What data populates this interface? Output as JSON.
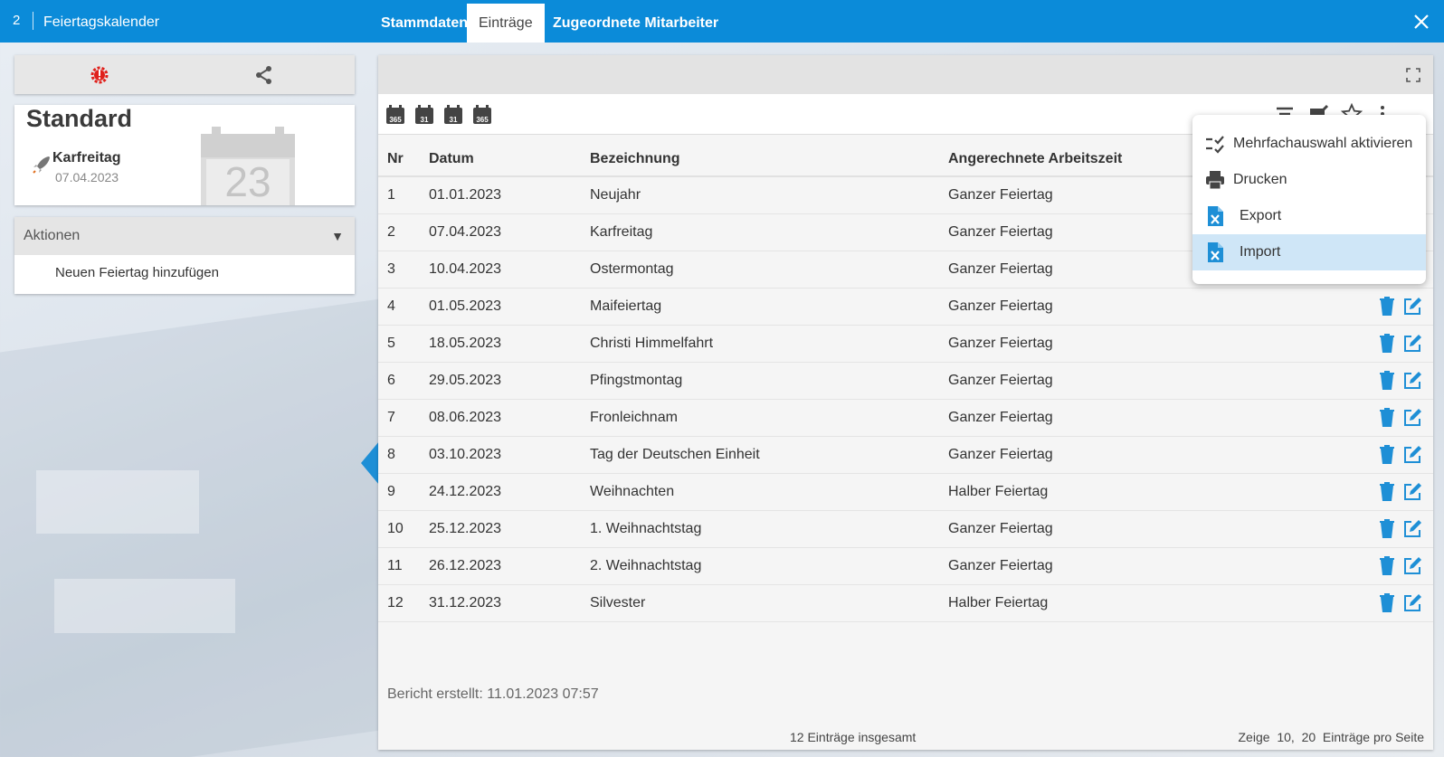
{
  "window": {
    "number": "2",
    "title": "Feiertagskalender",
    "tabs": [
      "Stammdaten",
      "Einträge",
      "Zugeordnete Mitarbeiter"
    ],
    "active_tab": "Einträge",
    "accent": "#0b8bd9"
  },
  "card": {
    "name": "Standard",
    "holiday_name": "Karfreitag",
    "holiday_date": "07.04.2023",
    "calendar_day": "23"
  },
  "actions": {
    "header": "Aktionen",
    "items": [
      "Neuen Feiertag hinzufügen"
    ]
  },
  "toolbar": {
    "calendar_buttons": [
      "365",
      "31",
      "31",
      "365"
    ]
  },
  "table": {
    "columns": [
      "Nr",
      "Datum",
      "Bezeichnung",
      "Angerechnete Arbeitszeit"
    ],
    "rows": [
      {
        "nr": "1",
        "datum": "01.01.2023",
        "bezeichnung": "Neujahr",
        "zeit": "Ganzer Feiertag"
      },
      {
        "nr": "2",
        "datum": "07.04.2023",
        "bezeichnung": "Karfreitag",
        "zeit": "Ganzer Feiertag"
      },
      {
        "nr": "3",
        "datum": "10.04.2023",
        "bezeichnung": "Ostermontag",
        "zeit": "Ganzer Feiertag"
      },
      {
        "nr": "4",
        "datum": "01.05.2023",
        "bezeichnung": "Maifeiertag",
        "zeit": "Ganzer Feiertag"
      },
      {
        "nr": "5",
        "datum": "18.05.2023",
        "bezeichnung": "Christi Himmelfahrt",
        "zeit": "Ganzer Feiertag"
      },
      {
        "nr": "6",
        "datum": "29.05.2023",
        "bezeichnung": "Pfingstmontag",
        "zeit": "Ganzer Feiertag"
      },
      {
        "nr": "7",
        "datum": "08.06.2023",
        "bezeichnung": "Fronleichnam",
        "zeit": "Ganzer Feiertag"
      },
      {
        "nr": "8",
        "datum": "03.10.2023",
        "bezeichnung": "Tag der Deutschen Einheit",
        "zeit": "Ganzer Feiertag"
      },
      {
        "nr": "9",
        "datum": "24.12.2023",
        "bezeichnung": "Weihnachten",
        "zeit": "Halber Feiertag"
      },
      {
        "nr": "10",
        "datum": "25.12.2023",
        "bezeichnung": "1. Weihnachtstag",
        "zeit": "Ganzer Feiertag"
      },
      {
        "nr": "11",
        "datum": "26.12.2023",
        "bezeichnung": "2. Weihnachtstag",
        "zeit": "Ganzer Feiertag"
      },
      {
        "nr": "12",
        "datum": "31.12.2023",
        "bezeichnung": "Silvester",
        "zeit": "Halber Feiertag"
      }
    ]
  },
  "report": "Bericht erstellt: 11.01.2023 07:57",
  "footer": {
    "total": "12 Einträge insgesamt",
    "show_label": "Zeige",
    "page_size_1": "10",
    "page_size_sep": ",",
    "page_size_2": "20",
    "per_page_label": "Einträge pro Seite"
  },
  "menu": {
    "items": [
      "Mehrfachauswahl aktivieren",
      "Drucken",
      "Export",
      "Import"
    ],
    "highlighted": "Import"
  },
  "colors": {
    "action_icon": "#1e8fd6",
    "power_icon": "#e0201b"
  }
}
